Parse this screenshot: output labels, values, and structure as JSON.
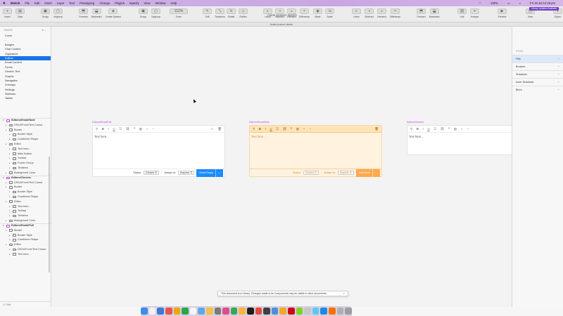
{
  "menubar": {
    "apple": "",
    "app": "Sketch",
    "items": [
      "File",
      "Edit",
      "Insert",
      "Layer",
      "Text",
      "Prototyping",
      "Arrange",
      "Plugins",
      "Spacify",
      "View",
      "Window",
      "Help"
    ],
    "battery": "100%",
    "clock": "Fri 19 Jul 12:28 pm"
  },
  "toolbar": {
    "doc_title": "Aside product sketch",
    "buttons": [
      {
        "label": "Insert",
        "glyph": "+"
      },
      {
        "label": "Data",
        "glyph": "▤"
      },
      {
        "label": "Group",
        "glyph": "▣"
      },
      {
        "label": "Ungroup",
        "glyph": "▢"
      },
      {
        "label": "Forward",
        "glyph": "⬒"
      },
      {
        "label": "Backward",
        "glyph": "⬓"
      },
      {
        "label": "Create Symbol",
        "glyph": "◈"
      },
      {
        "label": "Group",
        "glyph": "▣"
      },
      {
        "label": "Ungroup",
        "glyph": "▢"
      },
      {
        "label": "Zoom",
        "glyph": "112%"
      },
      {
        "label": "Edit",
        "glyph": "✎"
      },
      {
        "label": "Transform",
        "glyph": "⤡"
      },
      {
        "label": "Rotate",
        "glyph": "↻"
      },
      {
        "label": "Flatten",
        "glyph": "◇"
      },
      {
        "label": "Union",
        "glyph": "◐"
      },
      {
        "label": "Subtract",
        "glyph": "◑"
      },
      {
        "label": "Intersect",
        "glyph": "◒"
      },
      {
        "label": "Difference",
        "glyph": "◓"
      },
      {
        "label": "Mask",
        "glyph": "◉"
      },
      {
        "label": "Scale",
        "glyph": "⇲"
      },
      {
        "label": "Union",
        "glyph": "◐"
      },
      {
        "label": "Subtract",
        "glyph": "◑"
      },
      {
        "label": "Intersect",
        "glyph": "◒"
      },
      {
        "label": "Difference",
        "glyph": "◓"
      },
      {
        "label": "Forward",
        "glyph": "⬒"
      },
      {
        "label": "Backward",
        "glyph": "⬓"
      },
      {
        "label": "Link",
        "glyph": "⛓"
      },
      {
        "label": "Hotspot",
        "glyph": "⌖"
      },
      {
        "label": "Preview",
        "glyph": "▶"
      },
      {
        "label": "View",
        "glyph": "◫"
      },
      {
        "label": "Export",
        "glyph": "⇪"
      }
    ]
  },
  "doc_tab": "Aside product sketch",
  "left_panel": {
    "pages_header": "PAGES",
    "pages": [
      "Cover",
      "-",
      "Badges",
      "Chat Content",
      "Organisms",
      "Editors",
      "Email Content",
      "Forms",
      "Generic Text",
      "Graphs",
      "Navigation",
      "Overlays",
      "Settings",
      "Sidebars",
      "Tables"
    ],
    "selected_page": 5,
    "filter": "Filter",
    "layers": [
      {
        "type": "group",
        "name": "Editors/Email/Note"
      },
      {
        "type": "layer",
        "depth": 1,
        "name": "DS/UI/Form/Text Cursor"
      },
      {
        "type": "layer",
        "depth": 1,
        "name": "Border"
      },
      {
        "type": "layer",
        "depth": 2,
        "name": "Border Style"
      },
      {
        "type": "layer",
        "depth": 2,
        "name": "Combined Shape"
      },
      {
        "type": "layer",
        "depth": 1,
        "name": "Editor"
      },
      {
        "type": "layer",
        "depth": 2,
        "name": "Text here..."
      },
      {
        "type": "layer",
        "depth": 2,
        "name": "Main Button"
      },
      {
        "type": "layer",
        "depth": 2,
        "name": "Toolbar"
      },
      {
        "type": "layer",
        "depth": 2,
        "name": "Footer Group"
      },
      {
        "type": "layer",
        "depth": 2,
        "name": "Textarea"
      },
      {
        "type": "layer",
        "depth": 1,
        "name": "Background Color"
      },
      {
        "type": "group",
        "name": "Editors/Generic"
      },
      {
        "type": "layer",
        "depth": 1,
        "name": "DS/UI/Form/Text Cursor"
      },
      {
        "type": "layer",
        "depth": 1,
        "name": "Border"
      },
      {
        "type": "layer",
        "depth": 2,
        "name": "Border Style"
      },
      {
        "type": "layer",
        "depth": 2,
        "name": "Combined Shape"
      },
      {
        "type": "layer",
        "depth": 1,
        "name": "Editor"
      },
      {
        "type": "layer",
        "depth": 2,
        "name": "Text here..."
      },
      {
        "type": "layer",
        "depth": 2,
        "name": "Toolbar"
      },
      {
        "type": "layer",
        "depth": 2,
        "name": "Textarea"
      },
      {
        "type": "layer",
        "depth": 1,
        "name": "Background Color"
      },
      {
        "type": "group",
        "name": "Editors/Email/Full"
      },
      {
        "type": "layer",
        "depth": 1,
        "name": "Border"
      },
      {
        "type": "layer",
        "depth": 2,
        "name": "Border Style"
      },
      {
        "type": "layer",
        "depth": 2,
        "name": "Combined Shape"
      },
      {
        "type": "layer",
        "depth": 1,
        "name": "Editor"
      },
      {
        "type": "layer",
        "depth": 2,
        "name": "DS/UI/Form/Text Cursor"
      },
      {
        "type": "layer",
        "depth": 2,
        "name": "Text here..."
      }
    ]
  },
  "canvas": {
    "artboards": [
      {
        "label": "Editors/Email/Full",
        "placeholder": "Text here...",
        "status_label": "Status:",
        "status_value": "Closed",
        "assign_label": "Assign to:",
        "assign_value": "Anyone",
        "send_label": "Send Reply"
      },
      {
        "label": "Editors/Email/Note",
        "placeholder": "Text here...",
        "status_label": "Status:",
        "status_value": "Closed",
        "assign_label": "Assign to:",
        "assign_value": "Anyone",
        "send_label": "Add Note"
      },
      {
        "label": "Editors/Generic",
        "placeholder": "Text here..."
      }
    ]
  },
  "right_panel": {
    "style_header": "STYLE",
    "rows": [
      "Fills",
      "Borders",
      "Shadows",
      "Inner Shadows",
      "Blurs"
    ]
  },
  "toast": "This document is a Library. Changes made to its Components may be visible in other documents.",
  "library_badge": "Library Updates Available",
  "colors": {
    "accent": "#1a73e8",
    "send": "#1a8cff",
    "note": "#ffa94d",
    "artboard_label": "#c04bd8"
  }
}
